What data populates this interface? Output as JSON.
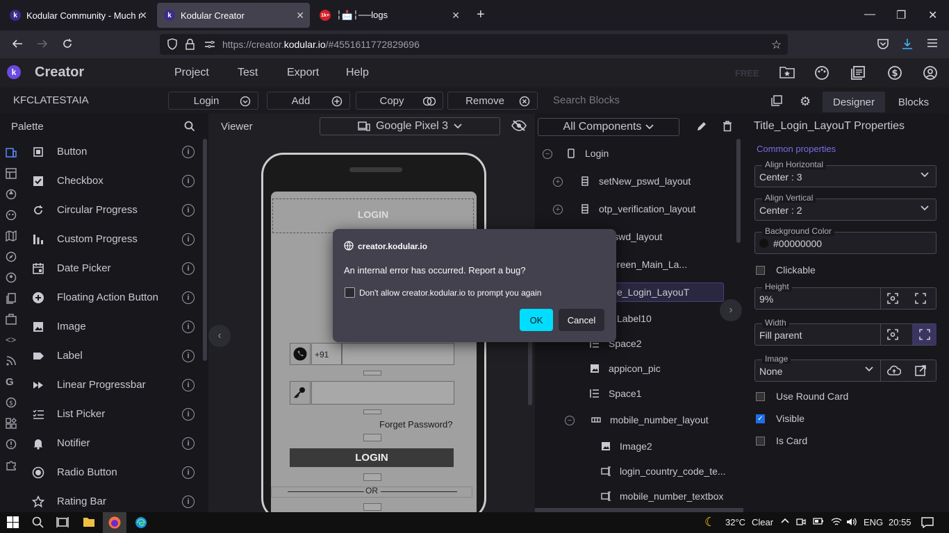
{
  "browser": {
    "tabs": [
      {
        "title": "Kodular Community - Much m",
        "favicon": "k"
      },
      {
        "title": "Kodular Creator",
        "favicon": "k"
      },
      {
        "title": "╎📩╎──logs",
        "favicon": "1k+"
      }
    ],
    "url_prefix": "https://creator.",
    "url_domain": "kodular.io",
    "url_suffix": "/#4551611772829696"
  },
  "app": {
    "brand": "Creator",
    "logo_letter": "k",
    "menu": [
      "Project",
      "Test",
      "Export",
      "Help"
    ],
    "free_label": "FREE"
  },
  "toolbar": {
    "project_name": "KFCLATESTAIA",
    "screen_select": "Login",
    "add": "Add",
    "copy": "Copy",
    "remove": "Remove",
    "search_placeholder": "Search Blocks",
    "designer": "Designer",
    "blocks": "Blocks"
  },
  "palette": {
    "title": "Palette",
    "items": [
      {
        "label": "Button",
        "icon": "button-icon"
      },
      {
        "label": "Checkbox",
        "icon": "checkbox-icon"
      },
      {
        "label": "Circular Progress",
        "icon": "circular-progress-icon"
      },
      {
        "label": "Custom Progress",
        "icon": "custom-progress-icon"
      },
      {
        "label": "Date Picker",
        "icon": "calendar-icon"
      },
      {
        "label": "Floating Action Button",
        "icon": "plus-circle-icon"
      },
      {
        "label": "Image",
        "icon": "image-icon"
      },
      {
        "label": "Label",
        "icon": "label-icon"
      },
      {
        "label": "Linear Progressbar",
        "icon": "fast-forward-icon"
      },
      {
        "label": "List Picker",
        "icon": "list-icon"
      },
      {
        "label": "Notifier",
        "icon": "bell-icon"
      },
      {
        "label": "Radio Button",
        "icon": "radio-icon"
      },
      {
        "label": "Rating Bar",
        "icon": "star-icon"
      }
    ]
  },
  "viewer": {
    "title": "Viewer",
    "device": "Google Pixel 3",
    "screen": {
      "title_text": "LOGIN",
      "country_code": "+91",
      "forget_password": "Forget Password?",
      "login_button": "LOGIN",
      "or_text": "OR"
    }
  },
  "components": {
    "selector": "All Components",
    "tree": [
      {
        "label": "Login",
        "icon": "phone-icon"
      },
      {
        "label": "setNew_pswd_layout",
        "icon": "vertical-layout-icon"
      },
      {
        "label": "otp_verification_layout",
        "icon": "vertical-layout-icon"
      },
      {
        "label": "et_pswd_layout",
        "icon": "vertical-layout-icon"
      },
      {
        "label": "n_Screen_Main_La...",
        "icon": "vertical-layout-icon"
      },
      {
        "label": "tle_Login_LayouT",
        "icon": "vertical-layout-icon"
      },
      {
        "label": "Label10",
        "icon": "label-icon"
      },
      {
        "label": "Space2",
        "icon": "space-icon"
      },
      {
        "label": "appicon_pic",
        "icon": "image-icon"
      },
      {
        "label": "Space1",
        "icon": "space-icon"
      },
      {
        "label": "mobile_number_layout",
        "icon": "horizontal-layout-icon"
      },
      {
        "label": "Image2",
        "icon": "image-icon"
      },
      {
        "label": "login_country_code_te...",
        "icon": "textbox-icon"
      },
      {
        "label": "mobile_number_textbox",
        "icon": "textbox-icon"
      }
    ]
  },
  "properties": {
    "title": "Title_Login_LayouT Properties",
    "section": "Common properties",
    "align_h_label": "Align Horizontal",
    "align_h_value": "Center : 3",
    "align_v_label": "Align Vertical",
    "align_v_value": "Center : 2",
    "bg_label": "Background Color",
    "bg_value": "#00000000",
    "clickable": "Clickable",
    "height_label": "Height",
    "height_value": "9%",
    "width_label": "Width",
    "width_value": "Fill parent",
    "image_label": "Image",
    "image_value": "None",
    "round_card": "Use Round Card",
    "visible": "Visible",
    "is_card": "Is Card"
  },
  "dialog": {
    "domain": "creator.kodular.io",
    "message": "An internal error has occurred. Report a bug?",
    "checkbox": "Don't allow creator.kodular.io to prompt you again",
    "ok": "OK",
    "cancel": "Cancel"
  },
  "taskbar": {
    "weather": "32°C",
    "weather_state": "Clear",
    "lang": "ENG",
    "time": "20:55"
  },
  "colors": {
    "accent": "#7b6ee8",
    "dialog_ok": "#00ddff",
    "checkbox_on": "#1f6fe6"
  }
}
